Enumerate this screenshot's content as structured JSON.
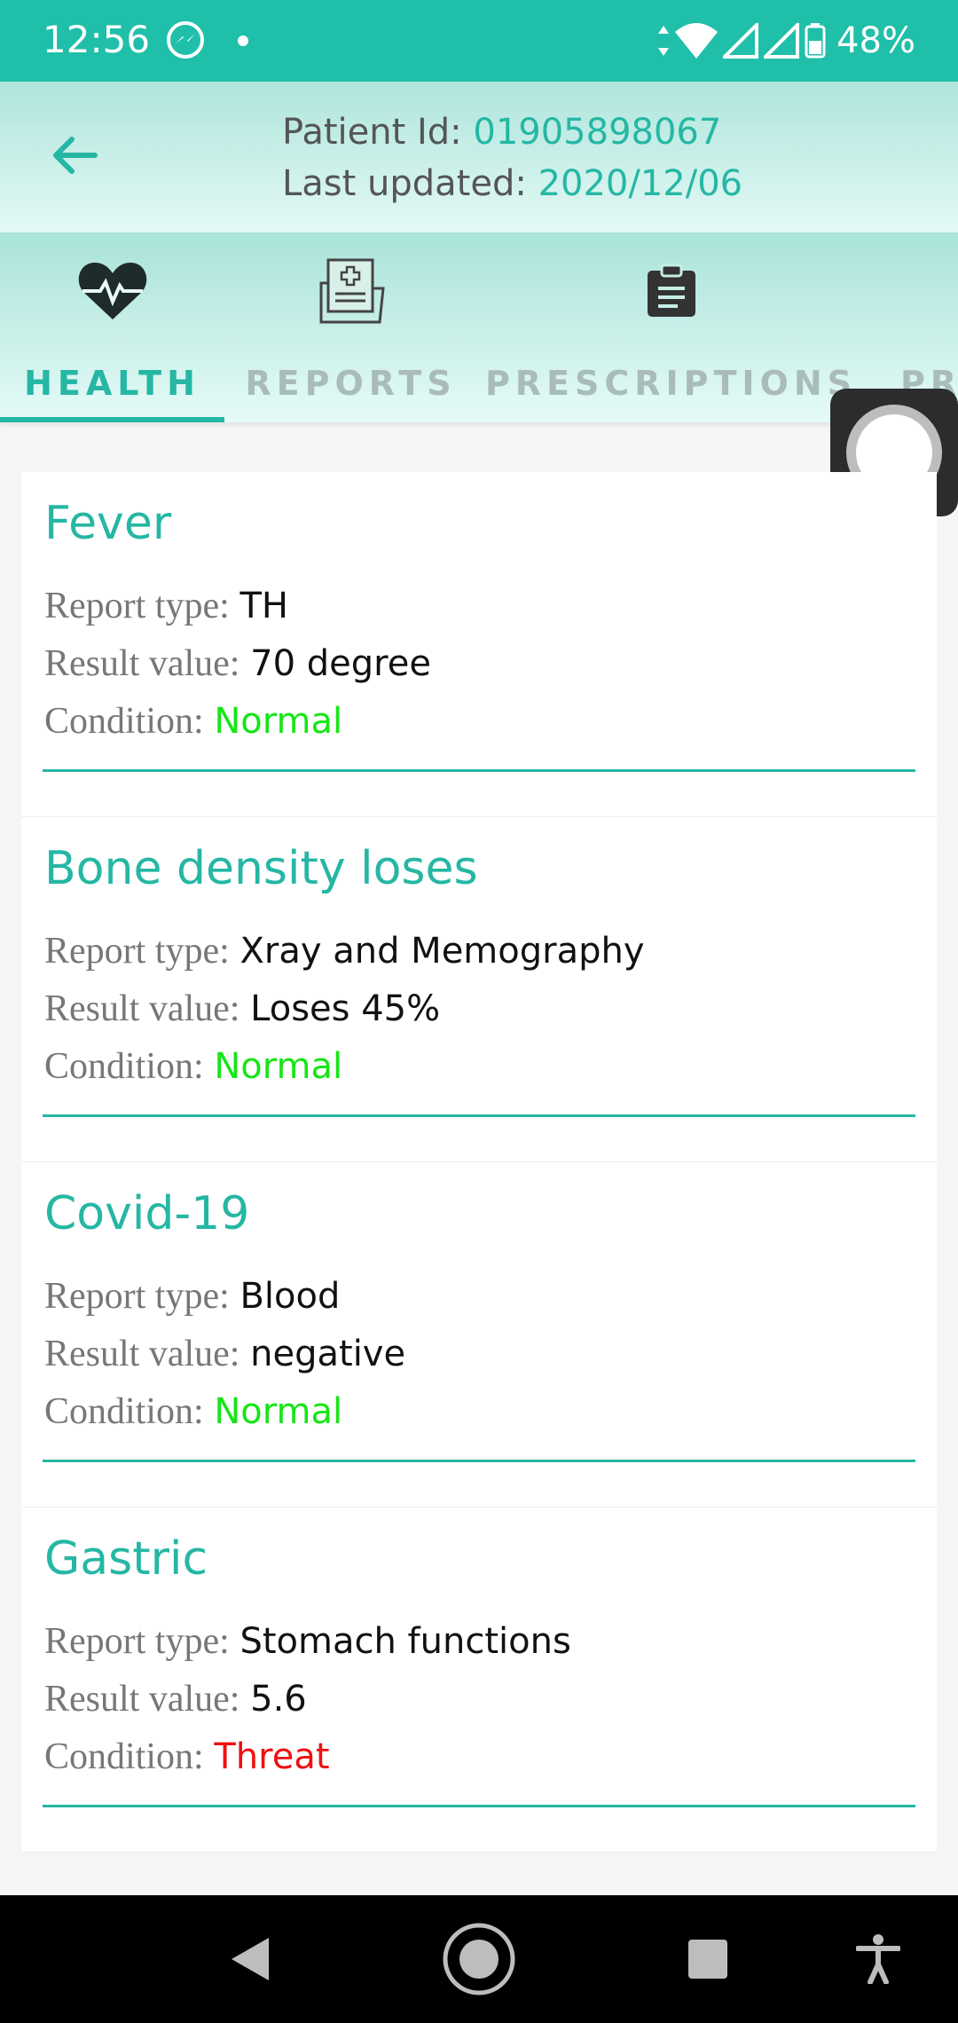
{
  "status_bar": {
    "time": "12:56",
    "battery": "48%",
    "icons": [
      "messenger-icon",
      "notification-dot",
      "data-arrows-icon",
      "wifi-icon",
      "signal-icon",
      "signal-icon",
      "battery-icon"
    ]
  },
  "header": {
    "patient_id_label": "Patient Id:",
    "patient_id_value": "01905898067",
    "last_updated_label": "Last updated:",
    "last_updated_value": "2020/12/06"
  },
  "tabs": [
    {
      "label": "HEALTH",
      "icon": "heartbeat-icon",
      "active": true
    },
    {
      "label": "REPORTS",
      "icon": "medical-folder-icon",
      "active": false
    },
    {
      "label": "PRESCRIPTIONS",
      "icon": "clipboard-icon",
      "active": false
    },
    {
      "label": "PR",
      "icon": "",
      "active": false
    }
  ],
  "labels": {
    "report_type": "Report type:",
    "result_value": "Result value:",
    "condition": "Condition:"
  },
  "records": [
    {
      "title": "Fever",
      "report_type": "TH",
      "result_value": "70 degree",
      "condition": "Normal"
    },
    {
      "title": "Bone density loses",
      "report_type": "Xray and Memography",
      "result_value": "Loses 45%",
      "condition": "Normal"
    },
    {
      "title": "Covid-19",
      "report_type": "Blood",
      "result_value": "negative",
      "condition": "Normal"
    },
    {
      "title": "Gastric",
      "report_type": "Stomach functions",
      "result_value": "5.6",
      "condition": "Threat"
    }
  ],
  "colors": {
    "accent": "#25b7a4",
    "status_bar": "#20bfa9",
    "normal": "#16e616",
    "threat": "#ee1111"
  },
  "nav_bar": {
    "icons": [
      "back-triangle-icon",
      "home-circle-icon",
      "recents-square-icon",
      "accessibility-icon"
    ]
  }
}
